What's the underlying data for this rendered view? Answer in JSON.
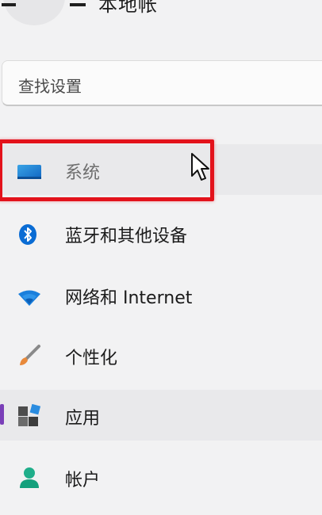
{
  "header": {
    "name_partial": "本地帐"
  },
  "search": {
    "placeholder": "查找设置"
  },
  "sidebar": {
    "items": [
      {
        "label": "系统",
        "icon": "system-display-icon",
        "state": "highlighted"
      },
      {
        "label": "蓝牙和其他设备",
        "icon": "bluetooth-icon"
      },
      {
        "label": "网络和 Internet",
        "icon": "wifi-icon"
      },
      {
        "label": "个性化",
        "icon": "brush-icon"
      },
      {
        "label": "应用",
        "icon": "apps-icon",
        "state": "selected"
      },
      {
        "label": "帐户",
        "icon": "account-icon"
      }
    ]
  },
  "colors": {
    "highlight_box": "#e3121b",
    "selected_indicator": "#7a3fb8",
    "accent_blue": "#0a6cd4"
  }
}
